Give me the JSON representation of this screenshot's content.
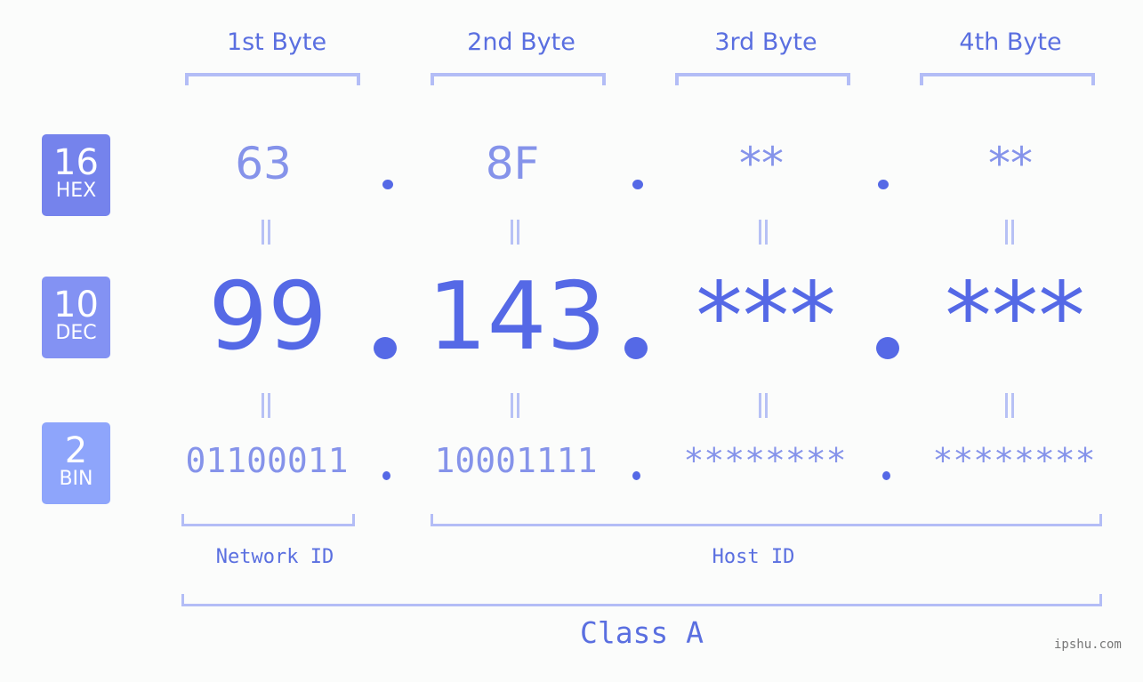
{
  "byte_headers": [
    "1st Byte",
    "2nd Byte",
    "3rd Byte",
    "4th Byte"
  ],
  "badges": [
    {
      "base": "16",
      "label": "HEX",
      "color": "#7583ec"
    },
    {
      "base": "10",
      "label": "DEC",
      "color": "#8392f3"
    },
    {
      "base": "2",
      "label": "BIN",
      "color": "#8ea5fb"
    }
  ],
  "hex": [
    "63",
    "8F",
    "**",
    "**"
  ],
  "dec": [
    "99",
    "143",
    "***",
    "***"
  ],
  "bin": [
    "01100011",
    "10001111",
    "********",
    "********"
  ],
  "network_label": "Network ID",
  "host_label": "Host ID",
  "class_label": "Class A",
  "watermark": "ipshu.com",
  "colors": {
    "accent": "#5569e6",
    "bracket": "#b3bdf6",
    "light_value": "#8593ea"
  }
}
